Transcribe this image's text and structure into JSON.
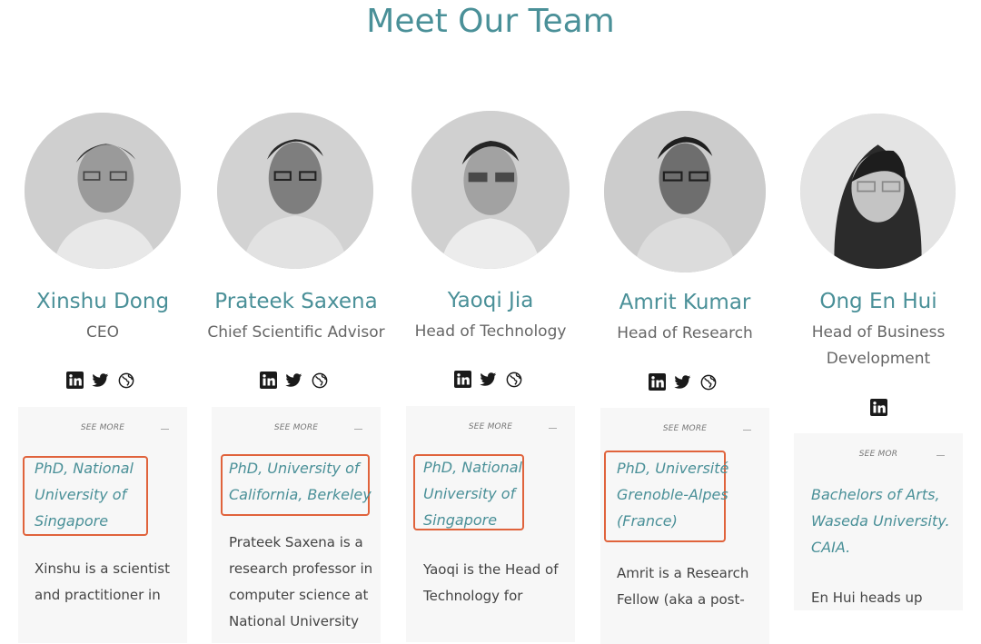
{
  "page": {
    "title": "Meet Our Team"
  },
  "team": [
    {
      "name": "Xinshu Dong",
      "role": "CEO",
      "socials": [
        "linkedin-icon",
        "twitter-icon",
        "globe-icon"
      ],
      "see_more": "SEE MORE",
      "degree": [
        "PhD, National",
        "University of",
        "Singapore"
      ],
      "bio": [
        "Xinshu is a scientist",
        "and practitioner in"
      ]
    },
    {
      "name": "Prateek Saxena",
      "role": "Chief Scientific Advisor",
      "socials": [
        "linkedin-icon",
        "twitter-icon",
        "globe-icon"
      ],
      "see_more": "SEE MORE",
      "degree": [
        "PhD, University of",
        "California, Berkeley"
      ],
      "bio": [
        "Prateek Saxena is a",
        "research professor in",
        "computer science at",
        "National University"
      ]
    },
    {
      "name": "Yaoqi Jia",
      "role": "Head of Technology",
      "socials": [
        "linkedin-icon",
        "twitter-icon",
        "globe-icon"
      ],
      "see_more": "SEE MORE",
      "degree": [
        "PhD, National",
        "University of",
        "Singapore"
      ],
      "bio": [
        "Yaoqi is the Head of",
        "Technology for"
      ]
    },
    {
      "name": "Amrit Kumar",
      "role": "Head of Research",
      "socials": [
        "linkedin-icon",
        "twitter-icon",
        "globe-icon"
      ],
      "see_more": "SEE MORE",
      "degree": [
        "PhD, Université",
        "Grenoble-Alpes",
        "(France)"
      ],
      "bio": [
        "Amrit is a Research",
        "Fellow (aka a post-"
      ]
    },
    {
      "name": "Ong En Hui",
      "role": [
        "Head of Business",
        "Development"
      ],
      "socials": [
        "linkedin-icon"
      ],
      "see_more": "SEE MOR",
      "degree": [
        "Bachelors of Arts,",
        "Waseda University.",
        "CAIA."
      ],
      "bio": [
        "En Hui heads up"
      ]
    }
  ]
}
